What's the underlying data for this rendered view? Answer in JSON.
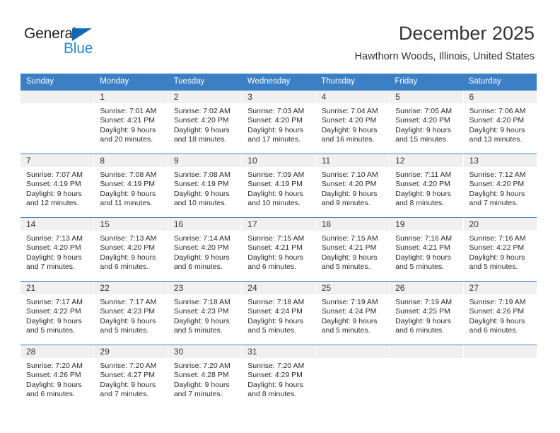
{
  "brand": {
    "name_top": "General",
    "name_bottom": "Blue",
    "triangle_color": "#1268b3",
    "blue_color": "#2a87d0"
  },
  "header": {
    "title": "December 2025",
    "location": "Hawthorn Woods, Illinois, United States"
  },
  "theme": {
    "header_band": "#3b7fc4",
    "day_band": "#f0f0f0",
    "text": "#2b2b2b"
  },
  "weekdays": [
    "Sunday",
    "Monday",
    "Tuesday",
    "Wednesday",
    "Thursday",
    "Friday",
    "Saturday"
  ],
  "weeks": [
    [
      {
        "day": "",
        "sunrise": "",
        "sunset": "",
        "daylight_line1": "",
        "daylight_line2": ""
      },
      {
        "day": "1",
        "sunrise": "Sunrise: 7:01 AM",
        "sunset": "Sunset: 4:21 PM",
        "daylight_line1": "Daylight: 9 hours",
        "daylight_line2": "and 20 minutes."
      },
      {
        "day": "2",
        "sunrise": "Sunrise: 7:02 AM",
        "sunset": "Sunset: 4:20 PM",
        "daylight_line1": "Daylight: 9 hours",
        "daylight_line2": "and 18 minutes."
      },
      {
        "day": "3",
        "sunrise": "Sunrise: 7:03 AM",
        "sunset": "Sunset: 4:20 PM",
        "daylight_line1": "Daylight: 9 hours",
        "daylight_line2": "and 17 minutes."
      },
      {
        "day": "4",
        "sunrise": "Sunrise: 7:04 AM",
        "sunset": "Sunset: 4:20 PM",
        "daylight_line1": "Daylight: 9 hours",
        "daylight_line2": "and 16 minutes."
      },
      {
        "day": "5",
        "sunrise": "Sunrise: 7:05 AM",
        "sunset": "Sunset: 4:20 PM",
        "daylight_line1": "Daylight: 9 hours",
        "daylight_line2": "and 15 minutes."
      },
      {
        "day": "6",
        "sunrise": "Sunrise: 7:06 AM",
        "sunset": "Sunset: 4:20 PM",
        "daylight_line1": "Daylight: 9 hours",
        "daylight_line2": "and 13 minutes."
      }
    ],
    [
      {
        "day": "7",
        "sunrise": "Sunrise: 7:07 AM",
        "sunset": "Sunset: 4:19 PM",
        "daylight_line1": "Daylight: 9 hours",
        "daylight_line2": "and 12 minutes."
      },
      {
        "day": "8",
        "sunrise": "Sunrise: 7:08 AM",
        "sunset": "Sunset: 4:19 PM",
        "daylight_line1": "Daylight: 9 hours",
        "daylight_line2": "and 11 minutes."
      },
      {
        "day": "9",
        "sunrise": "Sunrise: 7:08 AM",
        "sunset": "Sunset: 4:19 PM",
        "daylight_line1": "Daylight: 9 hours",
        "daylight_line2": "and 10 minutes."
      },
      {
        "day": "10",
        "sunrise": "Sunrise: 7:09 AM",
        "sunset": "Sunset: 4:19 PM",
        "daylight_line1": "Daylight: 9 hours",
        "daylight_line2": "and 10 minutes."
      },
      {
        "day": "11",
        "sunrise": "Sunrise: 7:10 AM",
        "sunset": "Sunset: 4:20 PM",
        "daylight_line1": "Daylight: 9 hours",
        "daylight_line2": "and 9 minutes."
      },
      {
        "day": "12",
        "sunrise": "Sunrise: 7:11 AM",
        "sunset": "Sunset: 4:20 PM",
        "daylight_line1": "Daylight: 9 hours",
        "daylight_line2": "and 8 minutes."
      },
      {
        "day": "13",
        "sunrise": "Sunrise: 7:12 AM",
        "sunset": "Sunset: 4:20 PM",
        "daylight_line1": "Daylight: 9 hours",
        "daylight_line2": "and 7 minutes."
      }
    ],
    [
      {
        "day": "14",
        "sunrise": "Sunrise: 7:13 AM",
        "sunset": "Sunset: 4:20 PM",
        "daylight_line1": "Daylight: 9 hours",
        "daylight_line2": "and 7 minutes."
      },
      {
        "day": "15",
        "sunrise": "Sunrise: 7:13 AM",
        "sunset": "Sunset: 4:20 PM",
        "daylight_line1": "Daylight: 9 hours",
        "daylight_line2": "and 6 minutes."
      },
      {
        "day": "16",
        "sunrise": "Sunrise: 7:14 AM",
        "sunset": "Sunset: 4:20 PM",
        "daylight_line1": "Daylight: 9 hours",
        "daylight_line2": "and 6 minutes."
      },
      {
        "day": "17",
        "sunrise": "Sunrise: 7:15 AM",
        "sunset": "Sunset: 4:21 PM",
        "daylight_line1": "Daylight: 9 hours",
        "daylight_line2": "and 6 minutes."
      },
      {
        "day": "18",
        "sunrise": "Sunrise: 7:15 AM",
        "sunset": "Sunset: 4:21 PM",
        "daylight_line1": "Daylight: 9 hours",
        "daylight_line2": "and 5 minutes."
      },
      {
        "day": "19",
        "sunrise": "Sunrise: 7:16 AM",
        "sunset": "Sunset: 4:21 PM",
        "daylight_line1": "Daylight: 9 hours",
        "daylight_line2": "and 5 minutes."
      },
      {
        "day": "20",
        "sunrise": "Sunrise: 7:16 AM",
        "sunset": "Sunset: 4:22 PM",
        "daylight_line1": "Daylight: 9 hours",
        "daylight_line2": "and 5 minutes."
      }
    ],
    [
      {
        "day": "21",
        "sunrise": "Sunrise: 7:17 AM",
        "sunset": "Sunset: 4:22 PM",
        "daylight_line1": "Daylight: 9 hours",
        "daylight_line2": "and 5 minutes."
      },
      {
        "day": "22",
        "sunrise": "Sunrise: 7:17 AM",
        "sunset": "Sunset: 4:23 PM",
        "daylight_line1": "Daylight: 9 hours",
        "daylight_line2": "and 5 minutes."
      },
      {
        "day": "23",
        "sunrise": "Sunrise: 7:18 AM",
        "sunset": "Sunset: 4:23 PM",
        "daylight_line1": "Daylight: 9 hours",
        "daylight_line2": "and 5 minutes."
      },
      {
        "day": "24",
        "sunrise": "Sunrise: 7:18 AM",
        "sunset": "Sunset: 4:24 PM",
        "daylight_line1": "Daylight: 9 hours",
        "daylight_line2": "and 5 minutes."
      },
      {
        "day": "25",
        "sunrise": "Sunrise: 7:19 AM",
        "sunset": "Sunset: 4:24 PM",
        "daylight_line1": "Daylight: 9 hours",
        "daylight_line2": "and 5 minutes."
      },
      {
        "day": "26",
        "sunrise": "Sunrise: 7:19 AM",
        "sunset": "Sunset: 4:25 PM",
        "daylight_line1": "Daylight: 9 hours",
        "daylight_line2": "and 6 minutes."
      },
      {
        "day": "27",
        "sunrise": "Sunrise: 7:19 AM",
        "sunset": "Sunset: 4:26 PM",
        "daylight_line1": "Daylight: 9 hours",
        "daylight_line2": "and 6 minutes."
      }
    ],
    [
      {
        "day": "28",
        "sunrise": "Sunrise: 7:20 AM",
        "sunset": "Sunset: 4:26 PM",
        "daylight_line1": "Daylight: 9 hours",
        "daylight_line2": "and 6 minutes."
      },
      {
        "day": "29",
        "sunrise": "Sunrise: 7:20 AM",
        "sunset": "Sunset: 4:27 PM",
        "daylight_line1": "Daylight: 9 hours",
        "daylight_line2": "and 7 minutes."
      },
      {
        "day": "30",
        "sunrise": "Sunrise: 7:20 AM",
        "sunset": "Sunset: 4:28 PM",
        "daylight_line1": "Daylight: 9 hours",
        "daylight_line2": "and 7 minutes."
      },
      {
        "day": "31",
        "sunrise": "Sunrise: 7:20 AM",
        "sunset": "Sunset: 4:29 PM",
        "daylight_line1": "Daylight: 9 hours",
        "daylight_line2": "and 8 minutes."
      },
      {
        "day": "",
        "sunrise": "",
        "sunset": "",
        "daylight_line1": "",
        "daylight_line2": ""
      },
      {
        "day": "",
        "sunrise": "",
        "sunset": "",
        "daylight_line1": "",
        "daylight_line2": ""
      },
      {
        "day": "",
        "sunrise": "",
        "sunset": "",
        "daylight_line1": "",
        "daylight_line2": ""
      }
    ]
  ]
}
